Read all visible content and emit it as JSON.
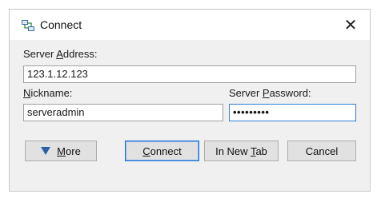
{
  "window": {
    "title": "Connect",
    "icon": "network-connect-icon",
    "close_glyph": "✕"
  },
  "form": {
    "server_address": {
      "label_pre": "Server ",
      "label_mnemonic": "A",
      "label_post": "ddress:",
      "value": "123.1.12.123"
    },
    "nickname": {
      "label_pre": "",
      "label_mnemonic": "N",
      "label_post": "ickname:",
      "value": "serveradmin"
    },
    "server_password": {
      "label_pre": "Server ",
      "label_mnemonic": "P",
      "label_post": "assword:",
      "value_masked": "•••••••••"
    }
  },
  "buttons": {
    "more": {
      "mnemonic": "M",
      "rest": "ore",
      "icon": "triangle-down-icon"
    },
    "connect": {
      "mnemonic": "C",
      "rest": "onnect"
    },
    "new_tab": {
      "pre": "In New ",
      "mnemonic": "T",
      "rest": "ab"
    },
    "cancel": {
      "label": "Cancel"
    }
  },
  "colors": {
    "focus_border": "#2f7fd0",
    "default_button_border": "#1c6fd0",
    "arrow": "#2a5faa"
  }
}
